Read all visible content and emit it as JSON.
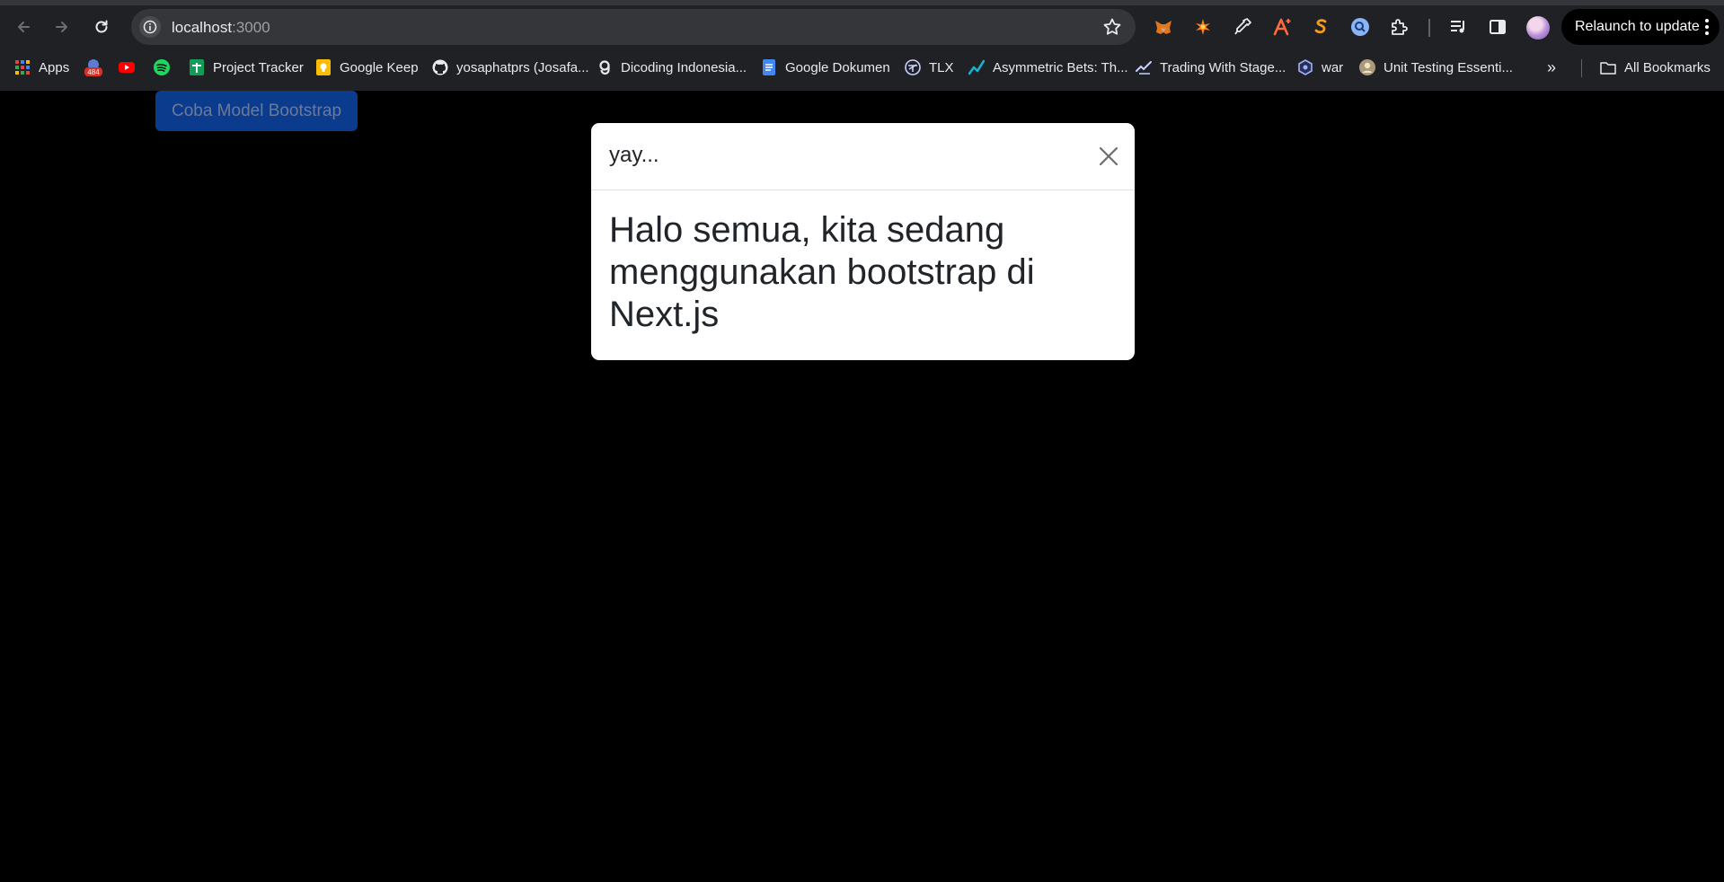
{
  "browser": {
    "url_host": "localhost",
    "url_port": ":3000",
    "relaunch_label": "Relaunch to update",
    "bookmarks": [
      {
        "label": "Apps",
        "icon": "apps-grid-icon"
      },
      {
        "label": "",
        "icon": "notification-badge-icon",
        "badge": "484"
      },
      {
        "label": "",
        "icon": "youtube-icon"
      },
      {
        "label": "",
        "icon": "spotify-icon"
      },
      {
        "label": "Project Tracker",
        "icon": "sheets-icon"
      },
      {
        "label": "Google Keep",
        "icon": "keep-icon"
      },
      {
        "label": "yosaphatprs (Josafa...",
        "icon": "github-icon"
      },
      {
        "label": "Dicoding Indonesia...",
        "icon": "dicoding-icon"
      },
      {
        "label": "Google Dokumen",
        "icon": "docs-icon"
      },
      {
        "label": "TLX",
        "icon": "tlx-icon"
      },
      {
        "label": "Asymmetric Bets: Th...",
        "icon": "chart-line-icon"
      },
      {
        "label": "Trading With Stage...",
        "icon": "trading-icon"
      },
      {
        "label": "war",
        "icon": "war-icon"
      },
      {
        "label": "Unit Testing Essenti...",
        "icon": "person-avatar-icon"
      }
    ],
    "all_bookmarks_label": "All Bookmarks",
    "colors": {
      "chrome_bg": "#202124",
      "omnibox_bg": "#35363a",
      "page_bg": "#000000"
    }
  },
  "page": {
    "trigger_button_label": "Coba Model Bootstrap",
    "modal": {
      "title": "yay...",
      "body": "Halo semua, kita sedang menggunakan bootstrap di Next.js"
    },
    "colors": {
      "button_bg": "#0a3b8c",
      "modal_bg": "#ffffff"
    }
  }
}
